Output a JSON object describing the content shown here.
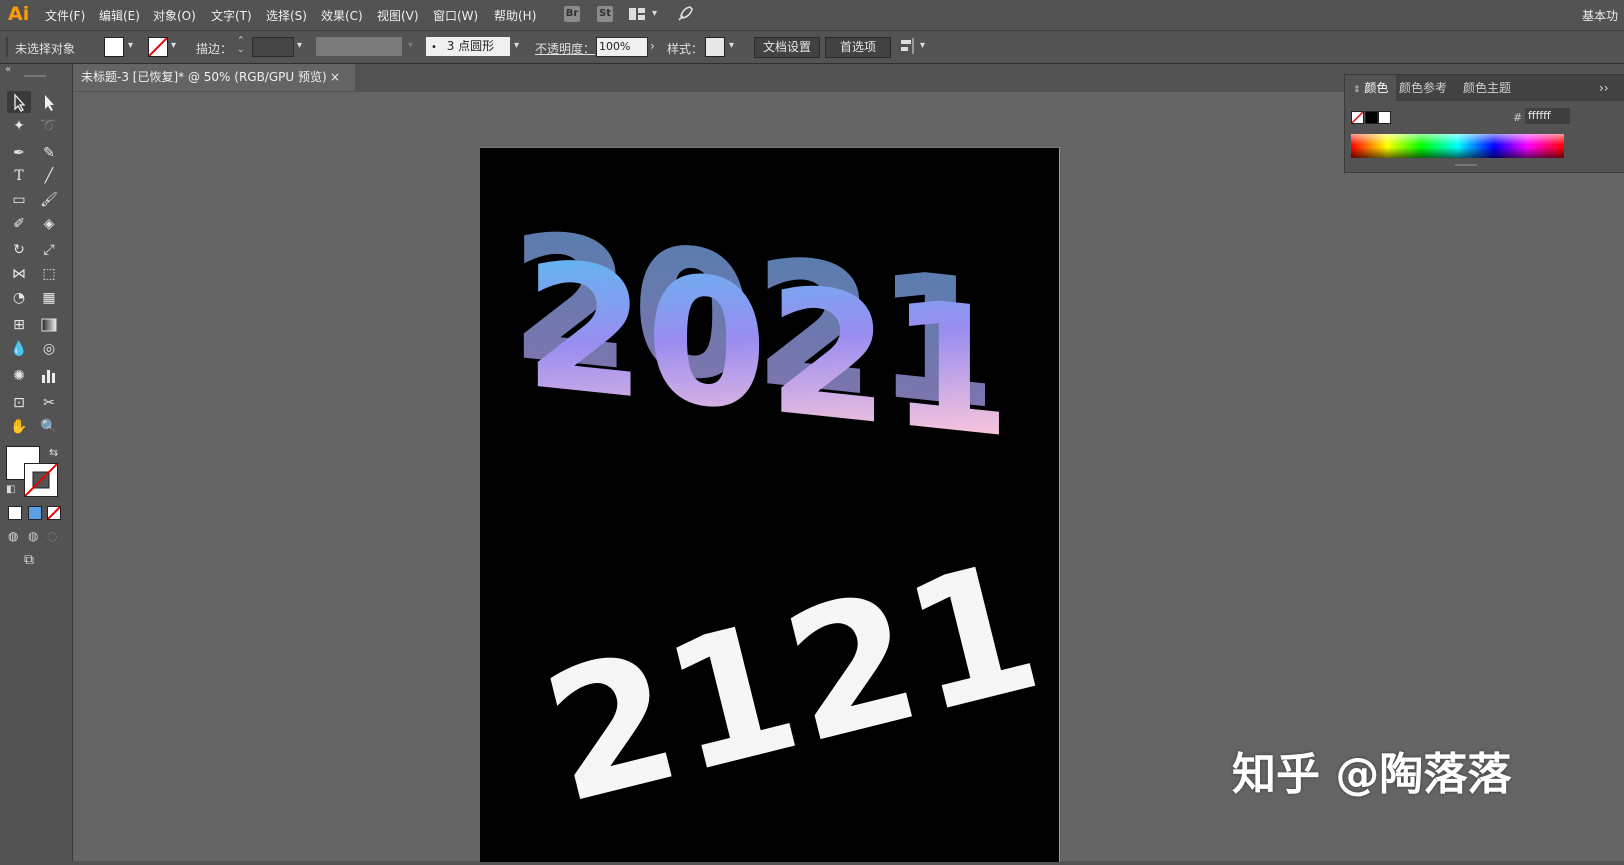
{
  "app": {
    "logo": "Ai",
    "workspace": "基本功"
  },
  "menu": [
    "文件(F)",
    "编辑(E)",
    "对象(O)",
    "文字(T)",
    "选择(S)",
    "效果(C)",
    "视图(V)",
    "窗口(W)",
    "帮助(H)"
  ],
  "menubar_icons": {
    "br": "Br",
    "st": "St"
  },
  "control": {
    "selection": "未选择对象",
    "stroke_label": "描边：",
    "brush": "3 点圆形",
    "opacity_label": "不透明度：",
    "opacity_value": "100%",
    "style_label": "样式：",
    "doc_setup": "文档设置",
    "preferences": "首选项"
  },
  "document": {
    "tab_title": "未标题-3 [已恢复]* @ 50% (RGB/GPU 预览)",
    "close": "×"
  },
  "color_panel": {
    "tabs": [
      "颜色",
      "颜色参考",
      "颜色主题"
    ],
    "hex_label": "#",
    "hex_value": "ffffff",
    "more": "››"
  },
  "artwork": {
    "top_text": "2021",
    "bottom_text": "2121",
    "gradient": [
      "#4fc3f0",
      "#9a8df0",
      "#f5c4dc"
    ]
  },
  "watermark": "知乎 @陶落落"
}
